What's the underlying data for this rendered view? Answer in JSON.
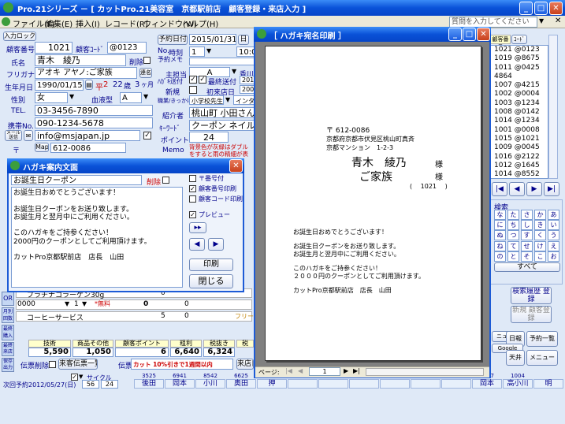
{
  "app": {
    "title": "Pro.21シリーズ － [ カットPro.21美容室　京都駅前店　顧客登録・来店入力 ]",
    "help_placeholder": "質問を入力してください"
  },
  "menu": [
    "ファイル(F)",
    "編集(E)",
    "挿入(I)",
    "レコード(R)",
    "ウィンドウ(W)",
    "ヘルプ(H)"
  ],
  "customer": {
    "input_lock": "入力ロック",
    "customer_no_label": "顧客番号",
    "customer_no": "1021",
    "customer_code_label": "顧客ｺｰﾄﾞ",
    "customer_code": "@0123",
    "name_label": "氏名",
    "name": "青木　綾乃",
    "delete_label": "削除",
    "furigana_label": "フリガナ",
    "furigana": "アオキ アヤノ:ご家族",
    "connect": "連名",
    "birth_label": "生年月日",
    "birth": "1990/01/15",
    "era_mark": "平",
    "era_year": "2",
    "age": "22",
    "age_unit": "歳",
    "months": "3",
    "months_unit": "ヶ月",
    "gender_label": "性別",
    "gender": "女",
    "blood_label": "血液型",
    "blood": "A",
    "tel_label": "TEL.",
    "tel": "03-3456-7890",
    "mobile_label": "携帯No.",
    "mobile": "090-1234-5678",
    "mail_label": "メール送信",
    "mail": "info@msjapan.jp",
    "zip_label": "〒",
    "map": "Map",
    "zip": "612-0086"
  },
  "reservation": {
    "date_btn": "予約日付",
    "date": "2015/01/31",
    "date_no": "日",
    "no_label": "No.",
    "time_label": "時刻",
    "time_no": "1",
    "time": "10:00",
    "memo_label": "予約メモ",
    "staff_label": "主担当",
    "staff": "A",
    "staff_name": "香川",
    "postcard_label": "ﾊｶﾞｷ送付",
    "last_sent_label": "最終送付",
    "last_sent": "2016",
    "new_label": "新規",
    "first_visit_label": "初来店日",
    "first_visit": "2002",
    "occupation_label": "職業/きっかけ",
    "occupation": "小学校先生",
    "trigger": "インター",
    "intro_label": "紹介者",
    "intro": "桃山町 小田さん",
    "keyword_label": "ｷｰﾜｰﾄﾞ",
    "keyword": "クーポン ネイル",
    "point_label": "ポイント",
    "point": "24",
    "memo2_label": "Memo",
    "notice": "背景色が灰緑はダブル をすると雨の精細が表"
  },
  "customer_list": {
    "header": "顧客番号",
    "code_btn": "ｺｰﾄﾞ",
    "rows": [
      "1021 @0123",
      "1019 @8675",
      "1011 @0425",
      "4864",
      "1007 @4215",
      "1002 @0004",
      "1003 @1234",
      "1008 @0142",
      "1014 @1234",
      "1001 @0008",
      "1015 @1021",
      "1009 @0045",
      "1016 @2122",
      "1012 @1645",
      "1014 @8552",
      "1012 @5552"
    ]
  },
  "search": {
    "title": "検索",
    "kana": [
      "な",
      "た",
      "さ",
      "か",
      "あ",
      "に",
      "ち",
      "し",
      "き",
      "い",
      "ぬ",
      "つ",
      "す",
      "く",
      "う",
      "ね",
      "て",
      "せ",
      "け",
      "え",
      "の",
      "と",
      "そ",
      "こ",
      "お"
    ],
    "all": "すべて",
    "history_btn": "検索履歴 登録",
    "new_btn": "新規 顧客登録"
  },
  "postcard_guide": {
    "title": "ハガキ案内文面",
    "subject": "お誕生日クーポン",
    "delete_label": "削除",
    "body": [
      "お誕生日おめでとうございます！",
      "",
      "お誕生日クーポンをお送り致します。",
      "お誕生月と翌月中にご利用ください。",
      "",
      "このハガキをご持参ください！",
      "2000円のクーポンとしてご利用頂けます。",
      "",
      "カットPro京都駅前店　店長　山田"
    ],
    "zip_check": "〒番号付",
    "custno_check": "顧客番号印刷",
    "custcode_check": "顧客コード印刷",
    "preview_check": "プレビュー",
    "print_btn": "印刷",
    "close_btn": "閉じる"
  },
  "print_preview": {
    "title": "［ ハガキ宛名印刷 ］",
    "zip": "〒 612-0086",
    "address1": "京都府京都市伏見区桃山町真斉",
    "address2": "京都マンション　1-2-3",
    "name": "青木　綾乃",
    "sama": "様",
    "family": "ご家族",
    "number": "( 　1021 　)",
    "body": [
      "お誕生日おめでとうございます！",
      "",
      "お誕生日クーポンをお送り致します。",
      "お誕生月と翌月中にご利用ください。",
      "",
      "このハガキをご持参ください！",
      "２０００円のクーポンとしてご利用頂けます。",
      "",
      "カットPro京都駅前店　店長　山田"
    ],
    "page_label": "ページ:",
    "page": "1"
  },
  "lower": {
    "item1": "プラチナコラーゲン30g",
    "item1_qty": "0",
    "code_row": "0000",
    "qty": "1",
    "disc_label": "*無料",
    "v0": "0",
    "v1": "0",
    "service": "コーヒーサービス",
    "service_qty": "5",
    "service_v": "0",
    "free_tag": "フリー",
    "side_or": "OR",
    "side_a": "月別 回数",
    "side_b": "最終 購入",
    "side_c": "最終 来店",
    "side_d": "保存 出力",
    "summary_headers": [
      "技術",
      "商品その他",
      "顧客ポイント",
      "粗利",
      "税抜き",
      "税"
    ],
    "summary_values": [
      "5,590",
      "1,050",
      "6",
      "6,640",
      "6,324"
    ],
    "slip_delete": "伝票削除",
    "slip_list": "来客伝票一覧",
    "slip_memo": "伝票メモ",
    "slip_note": "カット 10%引きで1週間以内",
    "visit_slip": "来店日",
    "next_label": "次回予約",
    "next_date": "2012/05/27(日)",
    "cycle_label": "サイクル",
    "cycle_a": "56",
    "cycle_b": "24",
    "bottom_staff": [
      "後田",
      "岡本",
      "小川",
      "奥田",
      "押",
      "",
      "",
      "",
      "",
      "",
      "",
      "岡本",
      "高小川",
      "明"
    ],
    "bottom_nums": [
      "3525",
      "6941",
      "8542",
      "6625",
      "",
      "",
      "",
      "",
      "",
      "",
      "",
      "1007",
      "1004"
    ],
    "side_right": [
      "ニュール",
      "日報",
      "予約一覧",
      "Google",
      "天井",
      "メニュー"
    ]
  }
}
